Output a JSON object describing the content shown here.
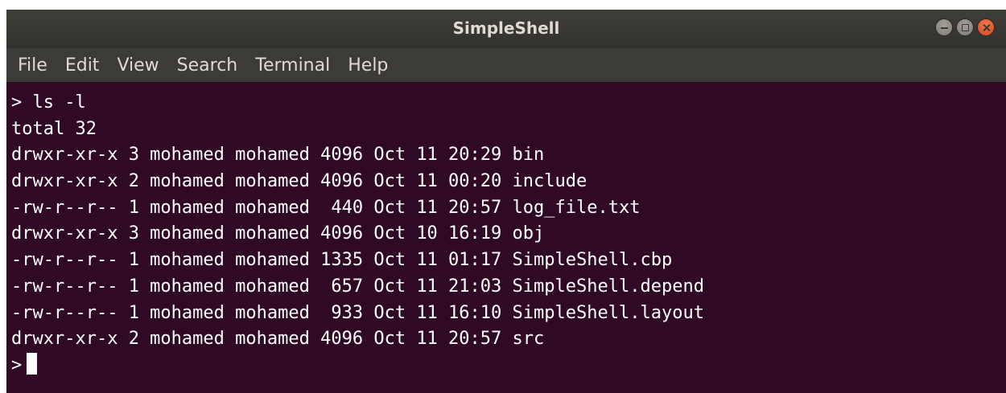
{
  "window": {
    "title": "SimpleShell"
  },
  "menu": [
    {
      "label": "File"
    },
    {
      "label": "Edit"
    },
    {
      "label": "View"
    },
    {
      "label": "Search"
    },
    {
      "label": "Terminal"
    },
    {
      "label": "Help"
    }
  ],
  "terminal": {
    "command_line": "> ls -l",
    "total_line": "total 32",
    "entries": [
      {
        "text": "drwxr-xr-x 3 mohamed mohamed 4096 Oct 11 20:29 bin"
      },
      {
        "text": "drwxr-xr-x 2 mohamed mohamed 4096 Oct 11 00:20 include"
      },
      {
        "text": "-rw-r--r-- 1 mohamed mohamed  440 Oct 11 20:57 log_file.txt"
      },
      {
        "text": "drwxr-xr-x 3 mohamed mohamed 4096 Oct 10 16:19 obj"
      },
      {
        "text": "-rw-r--r-- 1 mohamed mohamed 1335 Oct 11 01:17 SimpleShell.cbp"
      },
      {
        "text": "-rw-r--r-- 1 mohamed mohamed  657 Oct 11 21:03 SimpleShell.depend"
      },
      {
        "text": "-rw-r--r-- 1 mohamed mohamed  933 Oct 11 16:10 SimpleShell.layout"
      },
      {
        "text": "drwxr-xr-x 2 mohamed mohamed 4096 Oct 11 20:57 src"
      }
    ],
    "prompt": ">"
  },
  "colors": {
    "terminal_background": "#300a24",
    "titlebar": "#3c3b37",
    "close_button": "#e95420"
  },
  "icons": [
    "minimize-icon",
    "maximize-icon",
    "close-icon"
  ]
}
